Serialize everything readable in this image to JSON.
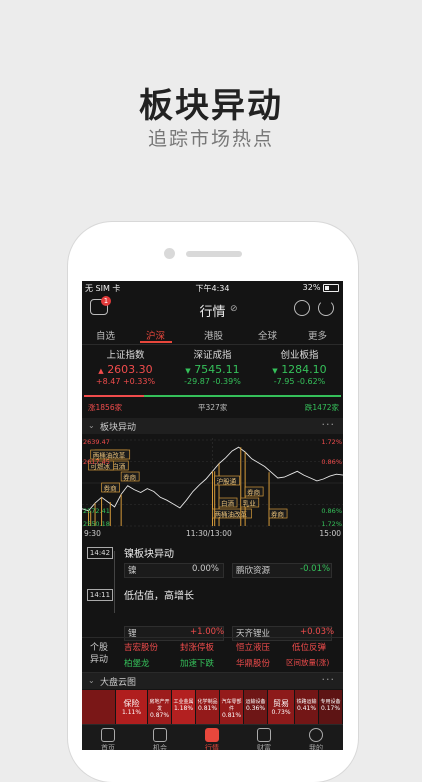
{
  "promo": {
    "title": "板块异动",
    "subtitle": "追踪市场热点"
  },
  "status": {
    "carrier": "无 SIM 卡",
    "time": "下午4:34",
    "battery": "32%"
  },
  "topbar": {
    "title": "行情",
    "message_badge": "1"
  },
  "tabs": [
    {
      "label": "自选"
    },
    {
      "label": "沪深"
    },
    {
      "label": "港股"
    },
    {
      "label": "全球"
    },
    {
      "label": "更多"
    }
  ],
  "indices": [
    {
      "name": "上证指数",
      "value": "2603.30",
      "arrow": "▲",
      "change": "+8.47",
      "pct": "+0.33%",
      "color": "#f04c4c"
    },
    {
      "name": "深证成指",
      "value": "7545.11",
      "arrow": "▼",
      "change": "-29.87",
      "pct": "-0.39%",
      "color": "#35c05a"
    },
    {
      "name": "创业板指",
      "value": "1284.10",
      "arrow": "▼",
      "change": "-7.95",
      "pct": "-0.62%",
      "color": "#35c05a"
    }
  ],
  "breadth": {
    "up": "涨1856家",
    "flat": "平327家",
    "down": "跌1472家"
  },
  "sector_section": {
    "title": "板块异动"
  },
  "chart_data": {
    "type": "line",
    "y_left_ticks": [
      "2639.47",
      "2617.45",
      "2572.41",
      "2550.18"
    ],
    "y_right_ticks": [
      "1.72%",
      "0.86%",
      "0.86%",
      "1.72%"
    ],
    "x_ticks": [
      "9:30",
      "11:30/13:00",
      "15:00"
    ],
    "x": [
      0,
      6,
      12,
      18,
      24,
      30,
      36,
      42,
      48,
      54,
      60,
      66,
      72,
      78,
      84,
      90,
      96,
      102,
      108,
      114,
      120,
      126,
      132,
      138,
      144,
      150,
      156,
      162,
      168,
      174,
      180,
      186,
      192,
      198,
      204,
      210,
      216,
      222,
      228,
      234,
      240
    ],
    "series": [
      {
        "values": [
          2568,
          2566,
          2574,
          2580,
          2575,
          2570,
          2583,
          2592,
          2588,
          2585,
          2589,
          2586,
          2580,
          2577,
          2573,
          2569,
          2577,
          2586,
          2593,
          2599,
          2607,
          2615,
          2621,
          2628,
          2632,
          2627,
          2620,
          2616,
          2612,
          2606,
          2600,
          2601,
          2604,
          2607,
          2603,
          2600,
          2597,
          2599,
          2602,
          2604,
          2603
        ]
      }
    ],
    "annotations": [
      {
        "label": "昨日涨停",
        "x": 12
      },
      {
        "label": "白酒",
        "x": 26
      },
      {
        "label": "券商",
        "x": 36
      },
      {
        "label": "券商",
        "x": 18
      },
      {
        "label": "两桶油改革",
        "x": 8
      },
      {
        "label": "可燃冰",
        "x": 6
      },
      {
        "label": "白酒",
        "x": 126
      },
      {
        "label": "两桶油改革",
        "x": 120
      },
      {
        "label": "沪股通",
        "x": 122
      },
      {
        "label": "券商",
        "x": 150
      },
      {
        "label": "乳业",
        "x": 146
      },
      {
        "label": "券商",
        "x": 172
      }
    ]
  },
  "timeline": [
    {
      "time": "14:42",
      "title": "镍板块异动",
      "cells": [
        {
          "name": "镍",
          "pct": "0.00%",
          "color": "#cccccc"
        },
        {
          "name": "鹏欣资源",
          "pct": "-0.01%",
          "color": "#35c05a"
        }
      ]
    },
    {
      "time": "14:11",
      "title": "低估值，高增长",
      "cells": [
        {
          "name": "锂",
          "pct": "+1.00%",
          "color": "#f04c4c"
        },
        {
          "name": "天齐锂业",
          "pct": "+0.03%",
          "color": "#f04c4c"
        }
      ]
    }
  ],
  "stock_movers": {
    "label": "个股异动",
    "items": [
      {
        "label": "吉宏股份",
        "color": "#f04c4c"
      },
      {
        "label": "封涨停板",
        "color": "#f04c4c"
      },
      {
        "label": "恒立液压",
        "color": "#f04c4c"
      },
      {
        "label": "低位反弹",
        "color": "#f04c4c"
      },
      {
        "label": "柏堡龙",
        "color": "#35c05a"
      },
      {
        "label": "加速下跌",
        "color": "#35c05a"
      },
      {
        "label": "华鼎股份",
        "color": "#f04c4c"
      },
      {
        "label": "区间放量(涨)",
        "color": "#f04c4c"
      }
    ]
  },
  "cloud_section": {
    "title": "大盘云图"
  },
  "heatmap": [
    {
      "name": "",
      "pct": "",
      "color": "#7a1717"
    },
    {
      "name": "保险",
      "pct": "1.11%",
      "color": "#b01e1e"
    },
    {
      "name": "房地产开发",
      "pct": "0.87%",
      "color": "#9c1c1c"
    },
    {
      "name": "工业金属",
      "pct": "1.18%",
      "color": "#b32020"
    },
    {
      "name": "化学制品",
      "pct": "0.81%",
      "color": "#941a1a"
    },
    {
      "name": "汽车零部件",
      "pct": "0.81%",
      "color": "#941a1a"
    },
    {
      "name": "运输设备",
      "pct": "0.36%",
      "color": "#6e1616"
    },
    {
      "name": "贸易",
      "pct": "0.73%",
      "color": "#8d1a1a"
    },
    {
      "name": "铁路运输",
      "pct": "0.41%",
      "color": "#731616"
    },
    {
      "name": "专用设备",
      "pct": "0.17%",
      "color": "#5d1414"
    }
  ],
  "nav": [
    {
      "label": "首页",
      "icon": "home-icon"
    },
    {
      "label": "机会",
      "icon": "opportunity-icon"
    },
    {
      "label": "行情",
      "icon": "market-icon"
    },
    {
      "label": "财富",
      "icon": "wealth-icon"
    },
    {
      "label": "我的",
      "icon": "profile-icon"
    }
  ]
}
